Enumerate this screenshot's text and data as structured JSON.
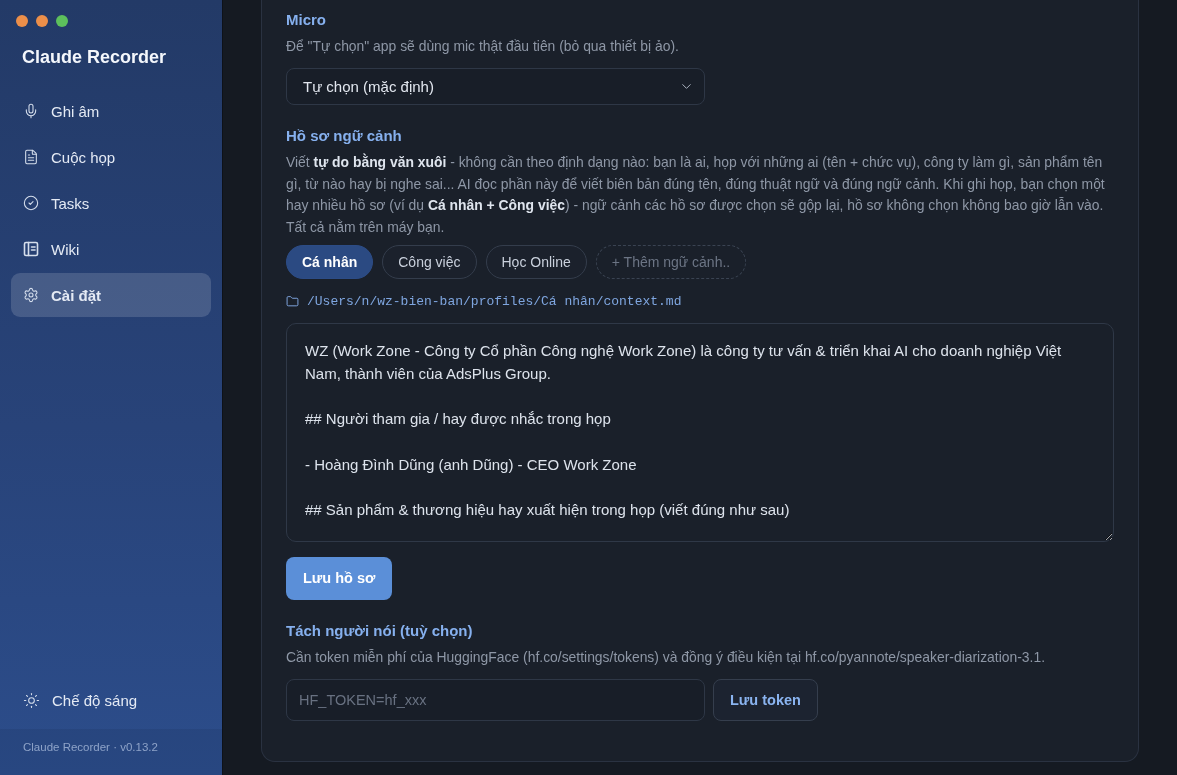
{
  "sidebar": {
    "title": "Claude Recorder",
    "items": [
      {
        "label": "Ghi âm",
        "selected": false
      },
      {
        "label": "Cuộc họp",
        "selected": false
      },
      {
        "label": "Tasks",
        "selected": false
      },
      {
        "label": "Wiki",
        "selected": false
      },
      {
        "label": "Cài đặt",
        "selected": true
      }
    ],
    "theme_toggle": {
      "label": "Chế độ sáng"
    },
    "footer": "Claude Recorder · v0.13.2"
  },
  "settings": {
    "microphone": {
      "heading": "Micro",
      "description": "Để \"Tự chọn\" app sẽ dùng mic thật đầu tiên (bỏ qua thiết bị ảo).",
      "select": {
        "value": "Tự chọn (mặc định)"
      }
    },
    "context_profiles": {
      "heading": "Hồ sơ ngữ cảnh",
      "description": "Viết **tự do bằng văn xuôi** - không cần theo định dạng nào: bạn là ai, họp với những ai (tên + chức vụ), công ty làm gì, sản phẩm tên gì, từ nào hay bị nghe sai... AI đọc phần này để viết biên bản đúng tên, đúng thuật ngữ và đúng ngữ cảnh. Khi ghi họp, bạn chọn một hay nhiều hồ sơ (ví dụ **Cá nhân + Công việc**) - ngữ cảnh các hồ sơ được chọn sẽ gộp lại, hồ sơ không chọn không bao giờ lẫn vào. Tất cả nằm trên máy bạn.",
      "profiles": [
        {
          "label": "Cá nhân",
          "selected": true
        },
        {
          "label": "Công việc",
          "selected": false
        },
        {
          "label": "Học Online",
          "selected": false
        }
      ],
      "add_button": "+ Thêm ngữ cảnh..",
      "file_path": "/Users/n/wz-bien-ban/profiles/Cá nhân/context.md",
      "editor": {
        "value": "WZ (Work Zone - Công ty Cổ phần Công nghệ Work Zone) là công ty tư vấn & triển khai AI cho doanh nghiệp Việt Nam, thành viên của AdsPlus Group.\n\n## Người tham gia / hay được nhắc trong họp\n\n- Hoàng Đình Dũng (anh Dũng) - CEO Work Zone\n\n## Sản phẩm & thương hiệu hay xuất hiện trong họp (viết đúng như sau)"
      },
      "save_button": "Lưu hồ sơ"
    },
    "speaker_diarization": {
      "heading": "Tách người nói (tuỳ chọn)",
      "description": "Cần token miễn phí của HuggingFace (hf.co/settings/tokens) và đồng ý điều kiện tại hf.co/pyannote/speaker-diarization-3.1.",
      "token_input": {
        "placeholder": "HF_TOKEN=hf_xxx"
      },
      "save_button": "Lưu token"
    }
  }
}
